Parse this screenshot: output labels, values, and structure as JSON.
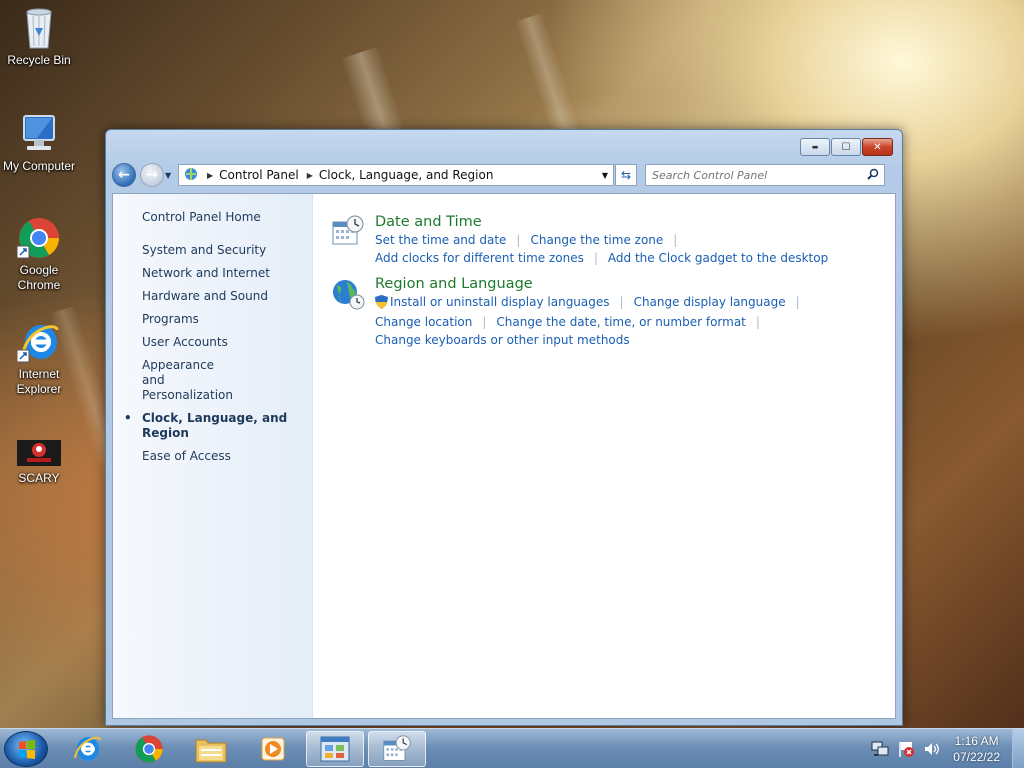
{
  "desktop": {
    "icons": [
      {
        "label": "Recycle Bin",
        "icon": "recycle-bin-icon"
      },
      {
        "label": "My Computer",
        "icon": "computer-icon"
      },
      {
        "label": "Google Chrome",
        "icon": "chrome-icon"
      },
      {
        "label": "Internet Explorer",
        "icon": "ie-icon"
      },
      {
        "label": "SCARY",
        "icon": "scary-icon"
      }
    ]
  },
  "window": {
    "caption_buttons": {
      "minimize": "▬",
      "maximize": "☐",
      "close": "✕"
    },
    "address": {
      "segments": [
        "Control Panel",
        "Clock, Language, and Region"
      ]
    },
    "search": {
      "placeholder": "Search Control Panel"
    },
    "sidebar": {
      "home": "Control Panel Home",
      "items": [
        "System and Security",
        "Network and Internet",
        "Hardware and Sound",
        "Programs",
        "User Accounts",
        "Appearance and Personalization",
        "Clock, Language, and Region",
        "Ease of Access"
      ],
      "current_index": 6
    },
    "categories": [
      {
        "title": "Date and Time",
        "icon": "clock-calendar-icon",
        "links": [
          "Set the time and date",
          "Change the time zone",
          "Add clocks for different time zones",
          "Add the Clock gadget to the desktop"
        ]
      },
      {
        "title": "Region and Language",
        "icon": "globe-clock-icon",
        "links": [
          "Install or uninstall display languages",
          "Change display language",
          "Change location",
          "Change the date, time, or number format",
          "Change keyboards or other input methods"
        ]
      }
    ]
  },
  "taskbar": {
    "pinned": [
      "internet-explorer-icon",
      "chrome-icon",
      "file-explorer-icon",
      "media-player-icon",
      "control-panel-icon",
      "clock-calendar-icon"
    ],
    "clock": {
      "time": "1:16 AM",
      "date": "07/22/22"
    }
  }
}
